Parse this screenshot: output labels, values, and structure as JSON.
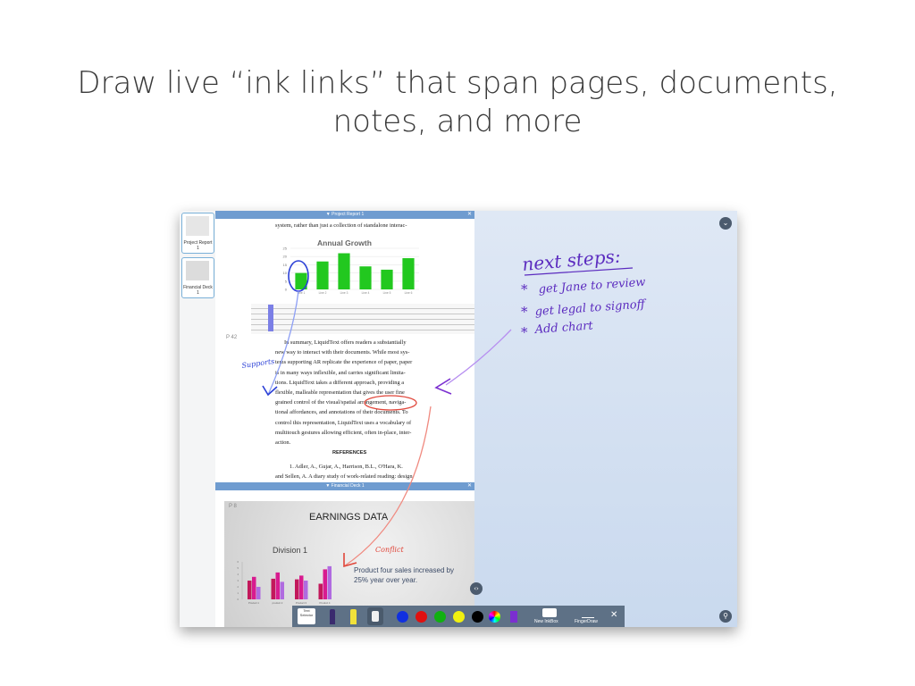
{
  "headline": {
    "line1": "Draw live “ink links” that span pages, documents,",
    "line2": "notes, and more"
  },
  "thumbnails": [
    {
      "label": "Project Report 1"
    },
    {
      "label": "Financial Deck 1"
    }
  ],
  "report_tab": {
    "title": "▼ Project Report 1",
    "close": "✕"
  },
  "deck_tab": {
    "title": "▼ Financial Deck 1",
    "close": "✕"
  },
  "report": {
    "top_line": "system, rather than just a collection of standalone interac-",
    "chart_title": "Annual Growth",
    "page_label": "P 42",
    "paragraph": [
      "In summary, LiquidText offers readers a substantially",
      "new way to interact with their documents. While most sys-",
      "tems supporting AR replicate the experience of paper, paper",
      "is in many ways inflexible, and carries significant limita-",
      "tions. LiquidText takes a different approach, providing a",
      "flexible, malleable representation that gives the user fine",
      "grained control of the visual/spatial arrangement, naviga-",
      "tional affordances, and annotations of their documents. To",
      "control this representation, LiquidText uses a vocabulary of",
      "multitouch gestures allowing efficient, often in-place, inter-",
      "action."
    ],
    "references_heading": "REFERENCES",
    "ref1_line1": "1.      Adler, A., Gujar, A., Harrison, B.L., O'Hara, K.",
    "ref1_line2": "and Sellen, A. A diary study of work-related reading: design"
  },
  "annual_growth_chart": {
    "type": "bar",
    "values": [
      10,
      17,
      22,
      14,
      12,
      19
    ],
    "ylim": [
      0,
      25
    ],
    "yticks": [
      "25",
      "20",
      "15",
      "10",
      "5",
      "0"
    ],
    "categories": [
      "Line 1",
      "Line 2",
      "Line 3",
      "Line 4",
      "Line 5",
      "Line 6"
    ],
    "color": "#22c81f"
  },
  "deck": {
    "page_label": "P 8",
    "slide_title": "EARNINGS DATA",
    "division": "Division 1",
    "caption_line1": "Product four sales increased by",
    "caption_line2": "25% year over year.",
    "chart_data": {
      "type": "bar",
      "categories": [
        "Product 1",
        "product 2",
        "Product 3",
        "Product 4"
      ],
      "series": [
        {
          "values": [
            3,
            3.3,
            3.2,
            2.5
          ]
        },
        {
          "values": [
            3.6,
            4.3,
            3.8,
            4.8
          ]
        },
        {
          "values": [
            2,
            2.8,
            3,
            5.3
          ]
        }
      ],
      "ylim": [
        0,
        6
      ],
      "colors": [
        "#c2185b",
        "#d81b8f",
        "#b06be0"
      ]
    }
  },
  "ink": {
    "supports": "Supports",
    "conflict": "Conflict",
    "next_steps": "next steps:",
    "items": [
      "get Jane to review",
      "get legal to signoff",
      "Add chart"
    ],
    "colors": {
      "blue": "#2a3fd6",
      "purple": "#7b2fd0",
      "red": "#e0463a",
      "lavender": "#b78ff0"
    }
  },
  "toolbar": {
    "text_tool": "Text Selector",
    "colors": [
      "#1030e0",
      "#e01010",
      "#10b010",
      "#f0f010",
      "#000000"
    ],
    "new_inkbox": "New InkBox",
    "finger_draw": "FingerDraw",
    "close": "✕"
  },
  "icons": {
    "collapse": "chevron-down-icon",
    "zoom": "zoom-icon",
    "arrows": "left-right-icon"
  }
}
